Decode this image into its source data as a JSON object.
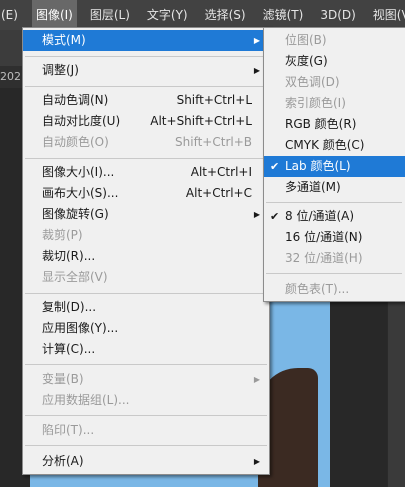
{
  "menubar": {
    "items": [
      "(E)",
      "图像(I)",
      "图层(L)",
      "文字(Y)",
      "选择(S)",
      "滤镜(T)",
      "3D(D)",
      "视图(V)"
    ],
    "active_index": 1
  },
  "background": {
    "tab_fragment": "202"
  },
  "image_menu": {
    "items": [
      {
        "label": "模式(M)",
        "shortcut": "",
        "submenu": true,
        "disabled": false
      },
      {
        "label": "调整(J)",
        "shortcut": "",
        "submenu": true,
        "disabled": false
      },
      {
        "label": "自动色调(N)",
        "shortcut": "Shift+Ctrl+L",
        "submenu": false,
        "disabled": false
      },
      {
        "label": "自动对比度(U)",
        "shortcut": "Alt+Shift+Ctrl+L",
        "submenu": false,
        "disabled": false
      },
      {
        "label": "自动颜色(O)",
        "shortcut": "Shift+Ctrl+B",
        "submenu": false,
        "disabled": true
      },
      {
        "label": "图像大小(I)...",
        "shortcut": "Alt+Ctrl+I",
        "submenu": false,
        "disabled": false
      },
      {
        "label": "画布大小(S)...",
        "shortcut": "Alt+Ctrl+C",
        "submenu": false,
        "disabled": false
      },
      {
        "label": "图像旋转(G)",
        "shortcut": "",
        "submenu": true,
        "disabled": false
      },
      {
        "label": "裁剪(P)",
        "shortcut": "",
        "submenu": false,
        "disabled": true
      },
      {
        "label": "裁切(R)...",
        "shortcut": "",
        "submenu": false,
        "disabled": false
      },
      {
        "label": "显示全部(V)",
        "shortcut": "",
        "submenu": false,
        "disabled": true
      },
      {
        "label": "复制(D)...",
        "shortcut": "",
        "submenu": false,
        "disabled": false
      },
      {
        "label": "应用图像(Y)...",
        "shortcut": "",
        "submenu": false,
        "disabled": false
      },
      {
        "label": "计算(C)...",
        "shortcut": "",
        "submenu": false,
        "disabled": false
      },
      {
        "label": "变量(B)",
        "shortcut": "",
        "submenu": true,
        "disabled": true
      },
      {
        "label": "应用数据组(L)...",
        "shortcut": "",
        "submenu": false,
        "disabled": true
      },
      {
        "label": "陷印(T)...",
        "shortcut": "",
        "submenu": false,
        "disabled": true
      },
      {
        "label": "分析(A)",
        "shortcut": "",
        "submenu": true,
        "disabled": false
      }
    ],
    "highlighted_index": 0
  },
  "mode_submenu": {
    "items": [
      {
        "label": "位图(B)",
        "disabled": true,
        "checked": false
      },
      {
        "label": "灰度(G)",
        "disabled": false,
        "checked": false
      },
      {
        "label": "双色调(D)",
        "disabled": true,
        "checked": false
      },
      {
        "label": "索引颜色(I)",
        "disabled": true,
        "checked": false
      },
      {
        "label": "RGB 颜色(R)",
        "disabled": false,
        "checked": false
      },
      {
        "label": "CMYK 颜色(C)",
        "disabled": false,
        "checked": false
      },
      {
        "label": "Lab 颜色(L)",
        "disabled": false,
        "checked": true
      },
      {
        "label": "多通道(M)",
        "disabled": false,
        "checked": false
      },
      {
        "label": "8 位/通道(A)",
        "disabled": false,
        "checked": true
      },
      {
        "label": "16 位/通道(N)",
        "disabled": false,
        "checked": false
      },
      {
        "label": "32 位/通道(H)",
        "disabled": true,
        "checked": false
      },
      {
        "label": "颜色表(T)...",
        "disabled": true,
        "checked": false
      }
    ],
    "highlighted_index": 6
  },
  "icons": {
    "submenu_arrow": "triangle-right-icon",
    "checkmark": "checkmark-icon"
  },
  "colors": {
    "highlight": "#1f7ad6",
    "menu_bg": "#f0f0f0",
    "menubar_bg": "#424242",
    "disabled_text": "#9a9a9a"
  }
}
